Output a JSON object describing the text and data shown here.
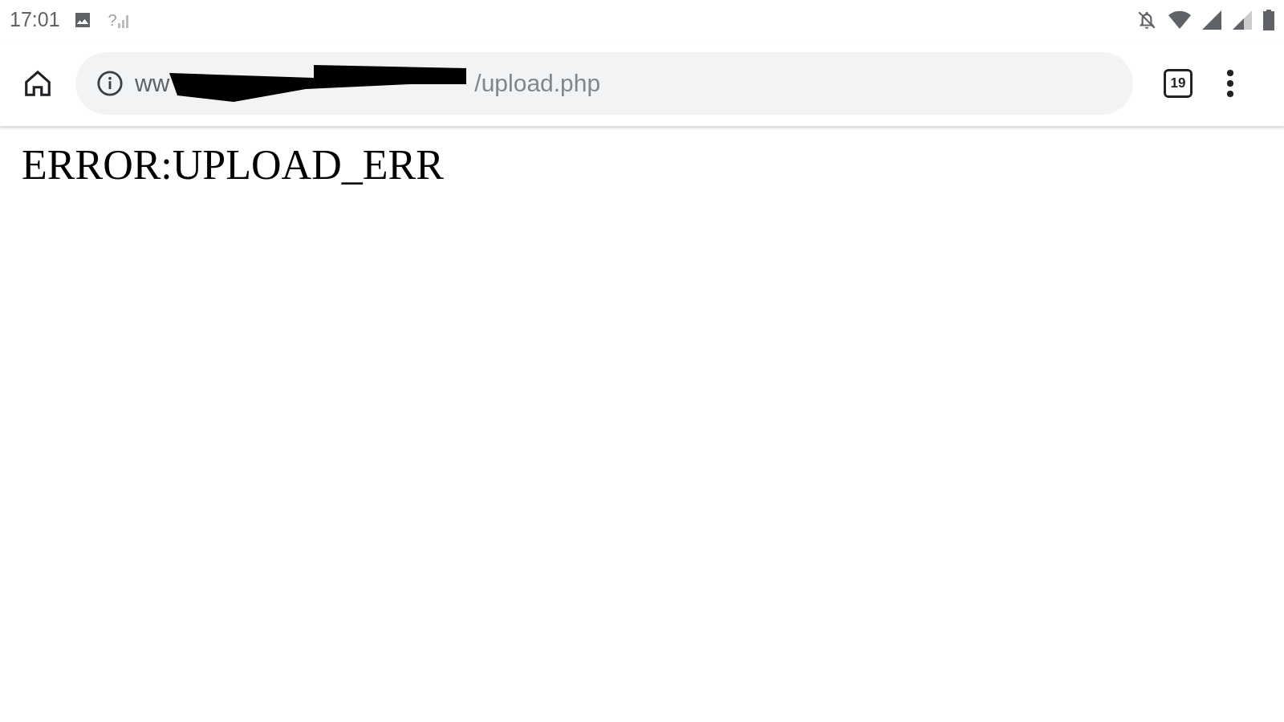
{
  "status_bar": {
    "time": "17:01",
    "signal_unknown_mark": "?"
  },
  "toolbar": {
    "url_start": "ww",
    "url_end": "/upload.php",
    "tab_count": "19"
  },
  "page": {
    "heading": "ERROR:UPLOAD_ERR"
  }
}
